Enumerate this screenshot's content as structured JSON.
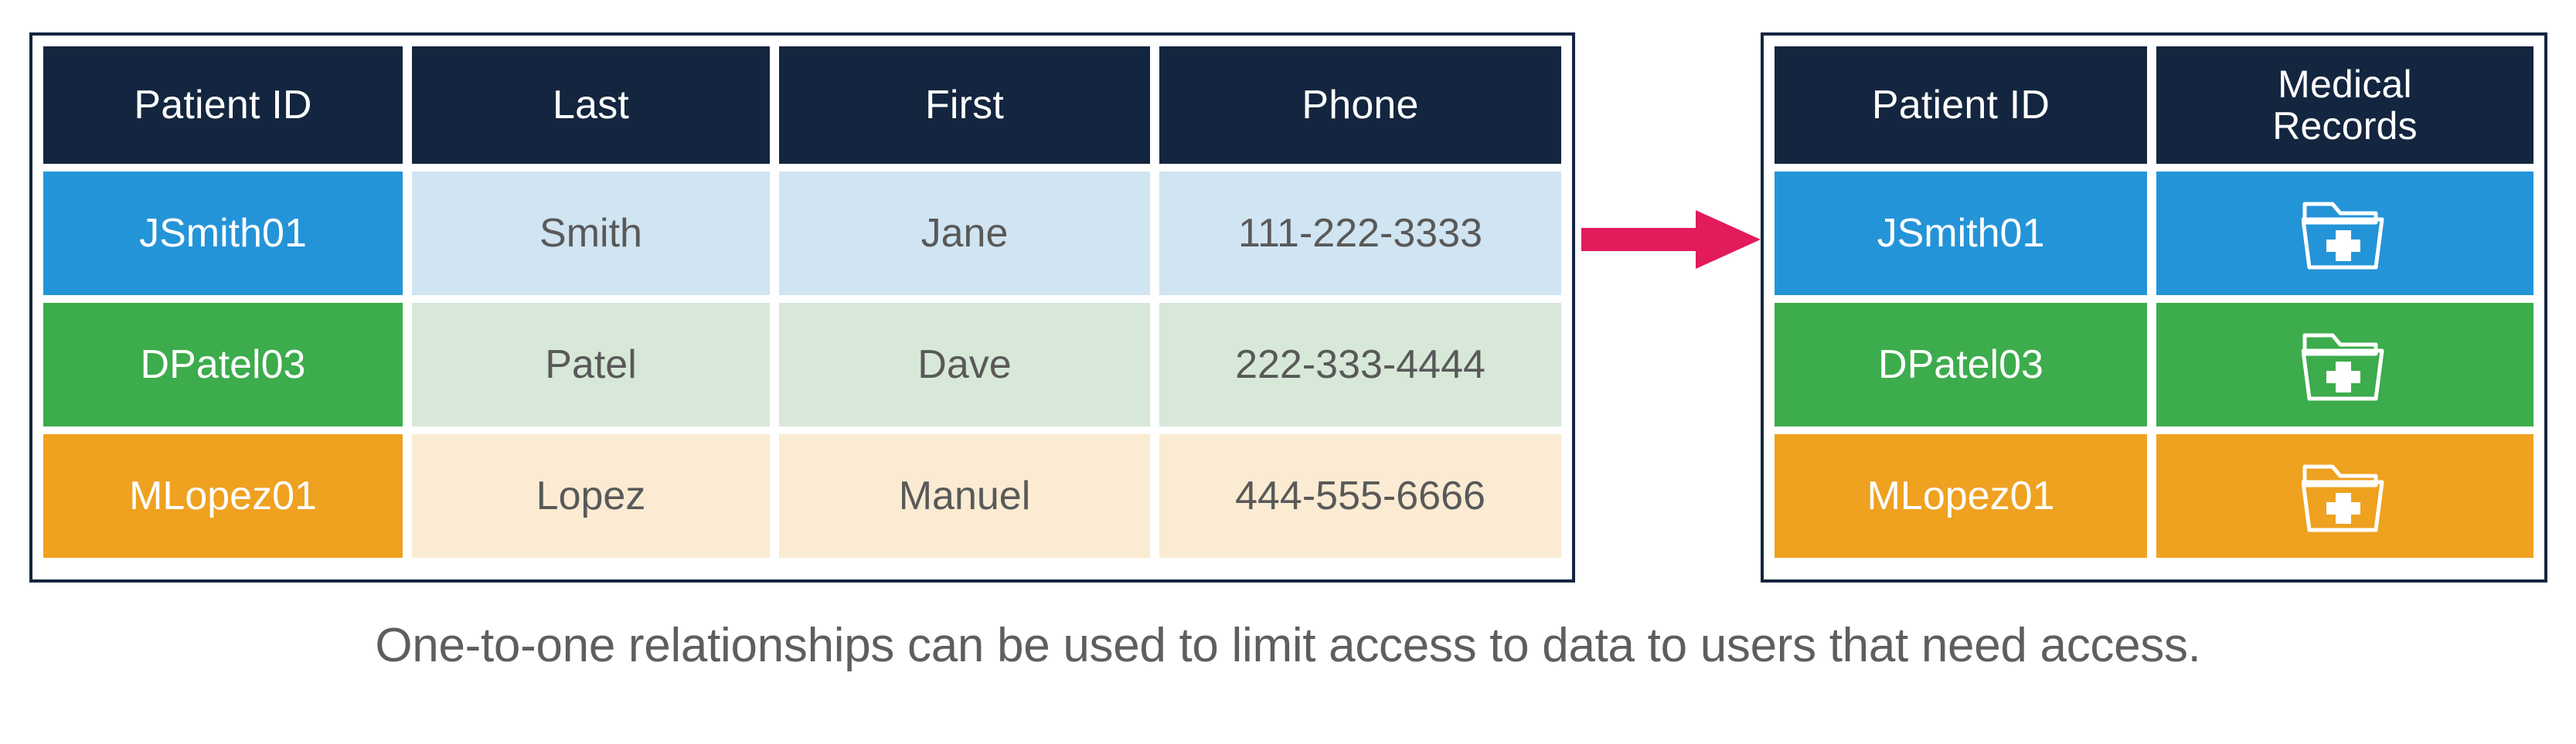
{
  "colors": {
    "navy": "#14263F",
    "blue": "#2494D8",
    "green": "#3DAC4C",
    "orange": "#EFA120",
    "tint_blue": "#D0E4F2",
    "tint_green": "#D7E8D8",
    "tint_orange": "#FBEBD2",
    "arrow": "#E21B5A",
    "body_text": "#595959",
    "caption_text": "#5E5E5E"
  },
  "patient_table": {
    "headers": [
      "Patient ID",
      "Last",
      "First",
      "Phone"
    ],
    "rows": [
      {
        "patient_id": "JSmith01",
        "last": "Smith",
        "first": "Jane",
        "phone": "111-222-3333"
      },
      {
        "patient_id": "DPatel03",
        "last": "Patel",
        "first": "Dave",
        "phone": "222-333-4444"
      },
      {
        "patient_id": "MLopez01",
        "last": "Lopez",
        "first": "Manuel",
        "phone": "444-555-6666"
      }
    ]
  },
  "records_table": {
    "headers": [
      "Patient ID",
      "Medical\nRecords"
    ],
    "header_medical_line1": "Medical",
    "header_medical_line2": "Records",
    "rows": [
      {
        "patient_id": "JSmith01",
        "record_icon": "medical-folder-icon"
      },
      {
        "patient_id": "DPatel03",
        "record_icon": "medical-folder-icon"
      },
      {
        "patient_id": "MLopez01",
        "record_icon": "medical-folder-icon"
      }
    ]
  },
  "arrow": {
    "icon": "right-arrow-icon",
    "direction": "right"
  },
  "caption": {
    "text": "One-to-one relationships can be used to limit access to data to users that need access."
  }
}
